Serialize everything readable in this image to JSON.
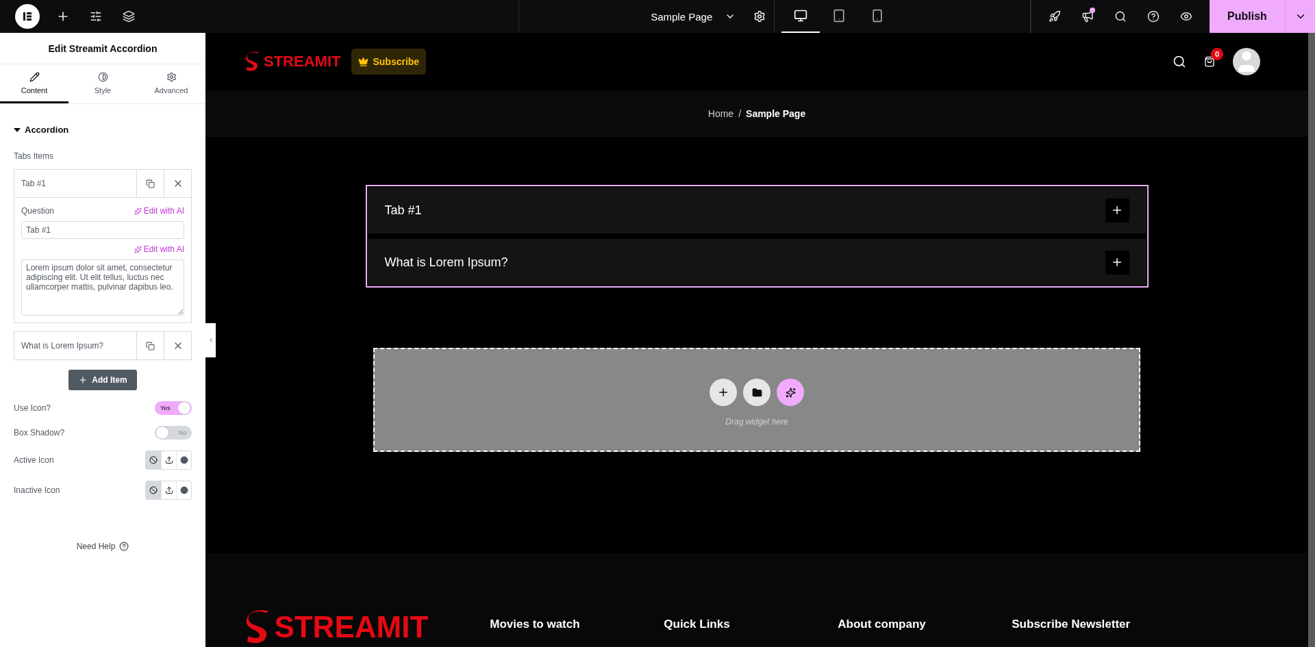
{
  "topbar": {
    "page_title": "Sample Page",
    "devices": [
      {
        "kind": "desktop",
        "selected": true
      },
      {
        "kind": "tablet",
        "selected": false
      },
      {
        "kind": "mobile",
        "selected": false
      }
    ],
    "whats_new_unread": true,
    "publish": "Publish"
  },
  "panel": {
    "title": "Edit Streamit Accordion",
    "tabs": [
      {
        "kind": "content",
        "label": "Content",
        "selected": true
      },
      {
        "kind": "style",
        "label": "Style",
        "selected": false
      },
      {
        "kind": "advanced",
        "label": "Advanced",
        "selected": false
      }
    ],
    "section": {
      "title": "Accordion",
      "expanded": true
    },
    "items_label": "Tabs Items",
    "items": [
      {
        "title": "Tab #1",
        "expanded": true,
        "question_label": "Question",
        "question_ai": "Edit with AI",
        "question": "Tab #1",
        "answer_ai": "Edit with AI",
        "answer": "Lorem ipsum dolor sit amet, consectetur adipiscing elit. Ut elit tellus, luctus nec ullamcorper mattis, pulvinar dapibus leo."
      },
      {
        "title": "What is Lorem Ipsum?",
        "expanded": false
      }
    ],
    "add_item": "Add Item",
    "switches": [
      {
        "label": "Use Icon?",
        "on": true,
        "text": "Yes"
      },
      {
        "label": "Box Shadow?",
        "on": false,
        "text": "No"
      }
    ],
    "icon_choosers": [
      {
        "label": "Active Icon",
        "options": [
          {
            "kind": "none",
            "selected": true
          },
          {
            "kind": "upload",
            "selected": false
          },
          {
            "kind": "library",
            "selected": false
          }
        ]
      },
      {
        "label": "Inactive Icon",
        "options": [
          {
            "kind": "none",
            "selected": true
          },
          {
            "kind": "upload",
            "selected": false
          },
          {
            "kind": "library",
            "selected": false
          }
        ]
      }
    ],
    "help": "Need Help"
  },
  "site": {
    "brand": "STREAMIT",
    "subscribe": "Subscribe",
    "cart_count": "0",
    "breadcrumb": [
      {
        "label": "Home",
        "current": false
      },
      {
        "label": "Sample Page",
        "current": true
      }
    ],
    "separator": "/",
    "accordion": [
      {
        "title": "Tab #1",
        "expanded": false
      },
      {
        "title": "What is Lorem Ipsum?",
        "expanded": false
      }
    ],
    "drop_hint": "Drag widget here",
    "footer": {
      "brand": "STREAMIT",
      "headings": [
        "Movies to watch",
        "Quick Links",
        "About company",
        "Subscribe Newsletter"
      ]
    }
  }
}
